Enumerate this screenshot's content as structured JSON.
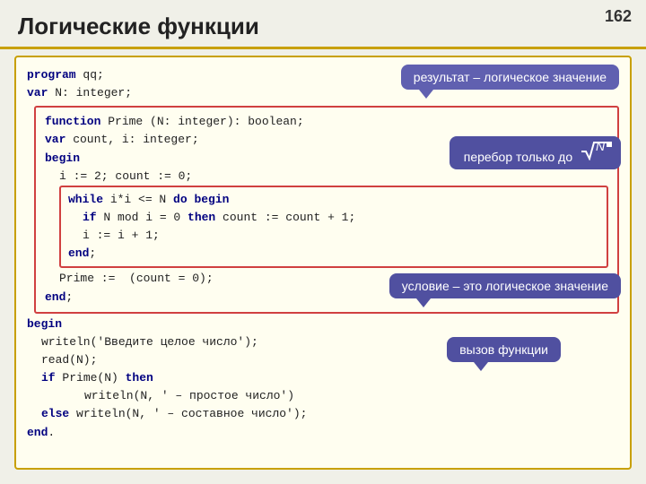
{
  "page": {
    "number": "162",
    "title": "Логические функции"
  },
  "callouts": {
    "result": "результат – логическое значение",
    "loop": "перебор только до",
    "loop_var": "N",
    "condition": "условие – это логическое значение",
    "call": "вызов функции"
  },
  "code": {
    "outer_lines": [
      "program qq;",
      "var N: integer;"
    ],
    "inner_lines": [
      "function Prime (N: integer): boolean;",
      "var count, i: integer;",
      "begin",
      "  i := 2; count := 0;",
      "  while i*i <= N do begin",
      "    if N mod i = 0 then count := count + 1;",
      "    i := i + 1;",
      "  end;",
      "  Prime :=  (count = 0);",
      "end;"
    ],
    "outer_lines2": [
      "begin",
      "  writeln('Введите целое число');",
      "  read(N);",
      "  if Prime(N) then",
      "       writeln(N, ' – простое число')",
      "  else writeln(N, ' – составное число');",
      "end."
    ]
  }
}
